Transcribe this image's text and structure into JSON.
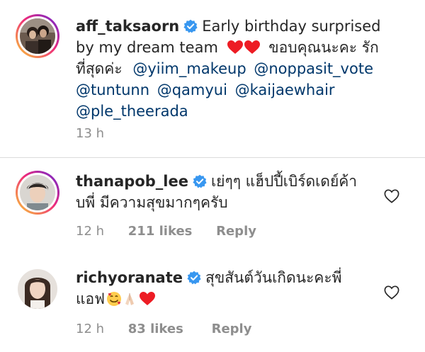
{
  "caption": {
    "username": "aff_taksaorn",
    "line1_text": "Early birthday surprised",
    "line2_text": "by my dream team",
    "line2_thai": "ขอบคุณนะคะ รัก",
    "line3_thai": "ที่สุดค่ะ",
    "mentions_line3": [
      "@yiim_makeup",
      "@noppasit_vote"
    ],
    "mentions_line4": [
      "@tuntunn",
      "@qamyui",
      "@kaijaewhair"
    ],
    "mentions_line5": [
      "@ple_theerada"
    ],
    "time": "13 h"
  },
  "comments": [
    {
      "username": "thanapob_lee",
      "text_line1": "เย่ๆๆ แฮ็ปปี้เบิร์ดเดย์ค้า",
      "text_line2": "บพี่ มีความสุขมากๆครับ",
      "time": "12 h",
      "likes": "211 likes",
      "reply": "Reply"
    },
    {
      "username": "richyoranate",
      "text_line1": "สุขสันต์วันเกิดนะคะพี่",
      "text_line2": "แอฟ",
      "time": "12 h",
      "likes": "83 likes",
      "reply": "Reply"
    }
  ],
  "colors": {
    "mention": "#00376b",
    "verified": "#3897f0",
    "heart": "#ed1c24",
    "meta": "#8e8e8e"
  },
  "icons": [
    "verified-badge-icon",
    "heart-outline-icon",
    "red-heart-emoji",
    "smiling-hearts-emoji",
    "praying-hands-emoji"
  ]
}
